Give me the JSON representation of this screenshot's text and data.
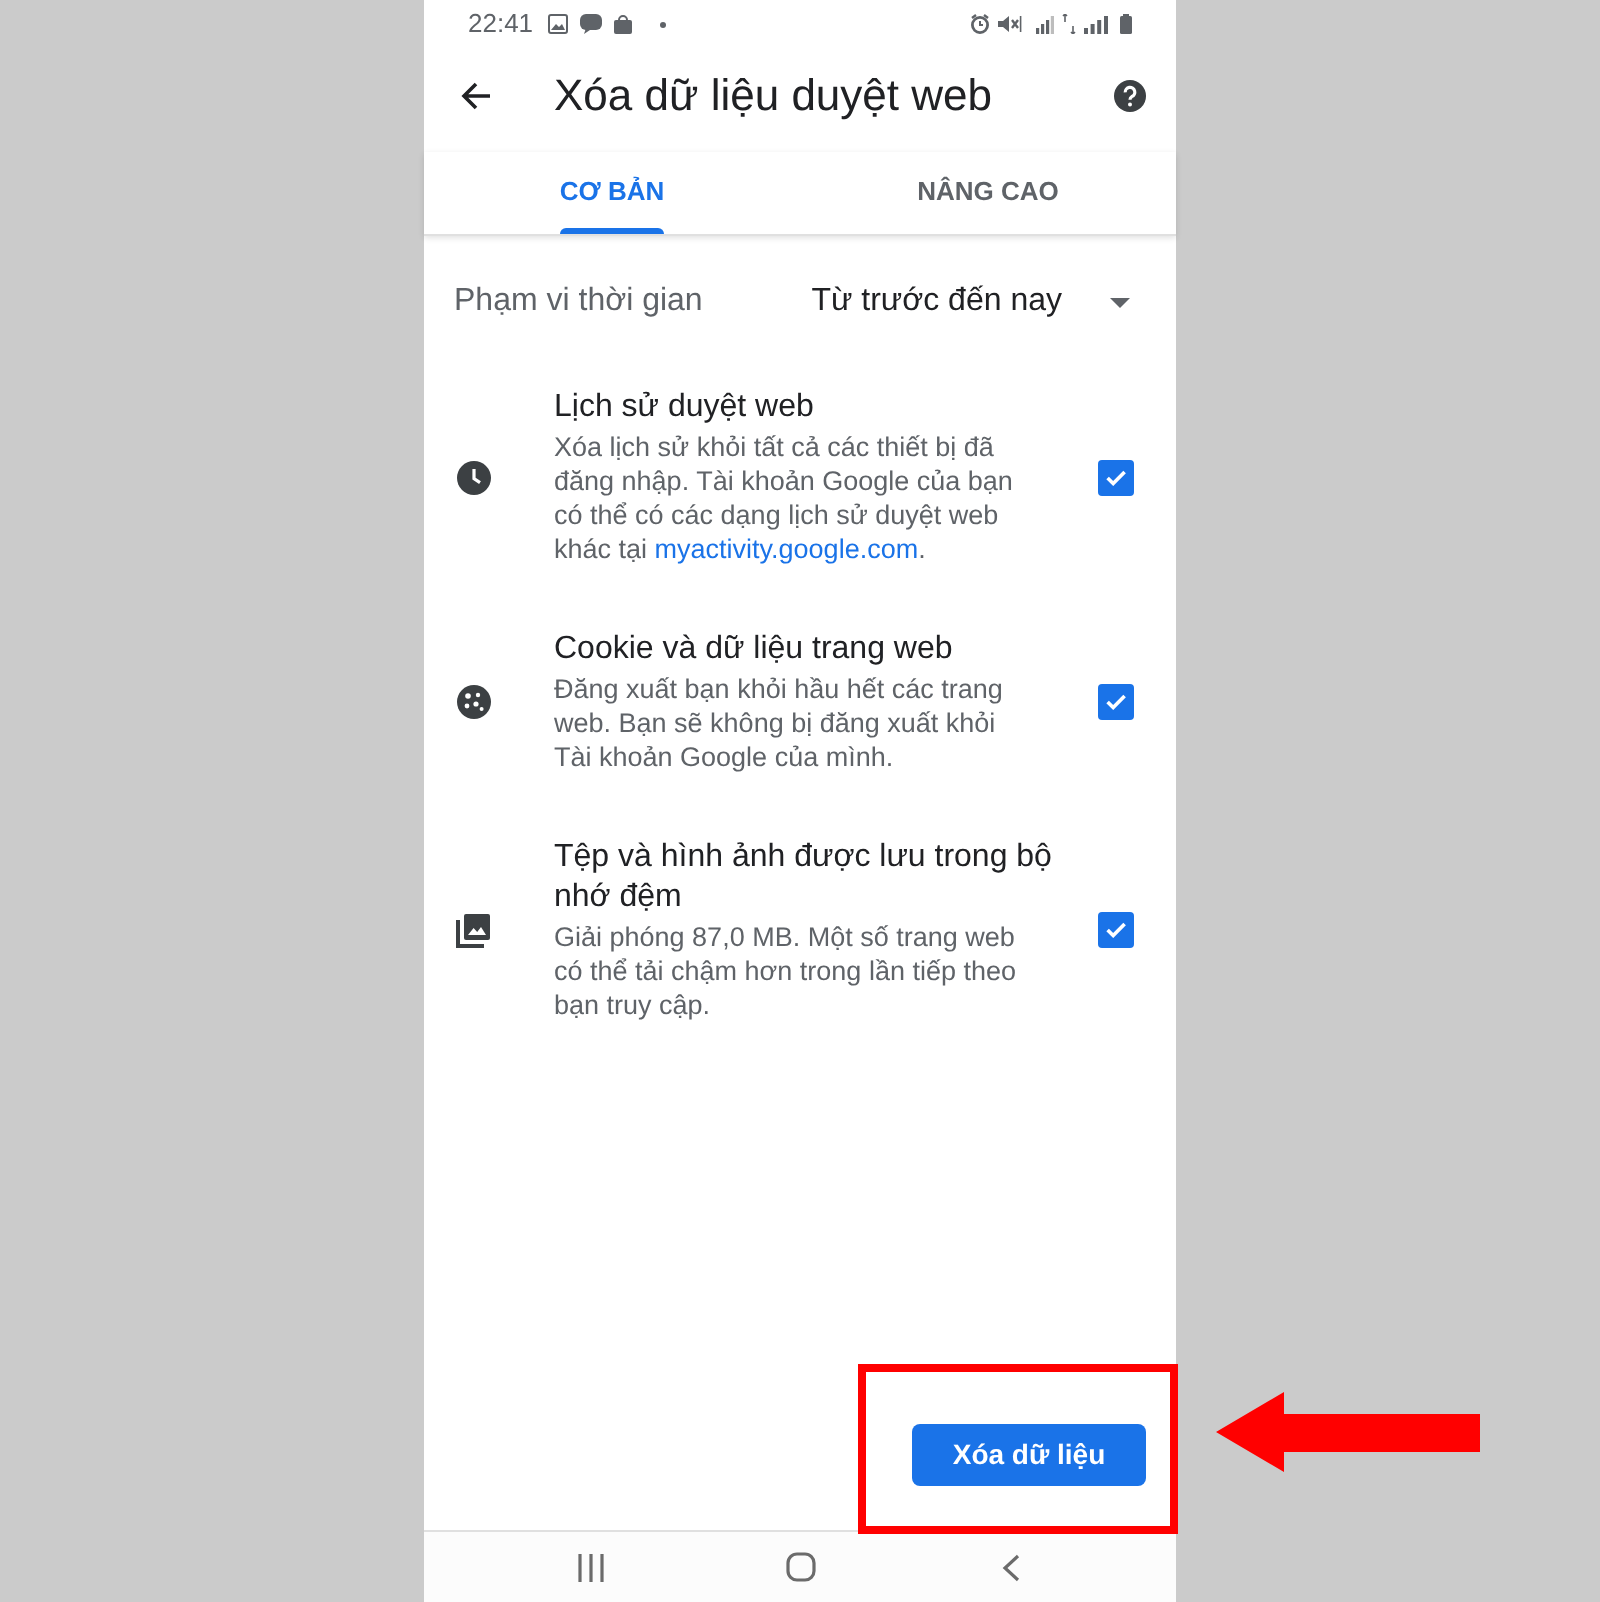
{
  "status_bar": {
    "time": "22:41"
  },
  "toolbar": {
    "title": "Xóa dữ liệu duyệt web"
  },
  "tabs": [
    {
      "label": "CƠ BẢN",
      "selected": true
    },
    {
      "label": "NÂNG CAO",
      "selected": false
    }
  ],
  "time_range": {
    "label": "Phạm vi thời gian",
    "value": "Từ trước đến nay"
  },
  "items": [
    {
      "kind": "history",
      "title": "Lịch sử duyệt web",
      "description": [
        {
          "text": "Xóa lịch sử khỏi tất cả các thiết bị đã đăng nhập. Tài khoản Google của bạn có thể có các dạng lịch sử duyệt web khác tại "
        },
        {
          "kind": "link",
          "text": "myactivity.google.com"
        },
        {
          "text": "."
        }
      ],
      "checked": true
    },
    {
      "kind": "cookies",
      "title": "Cookie và dữ liệu trang web",
      "description": [
        {
          "text": "Đăng xuất bạn khỏi hầu hết các trang web. Bạn sẽ không bị đăng xuất khỏi Tài khoản Google của mình."
        }
      ],
      "checked": true
    },
    {
      "kind": "cache",
      "title": "Tệp và hình ảnh được lưu trong bộ nhớ đệm",
      "description": [
        {
          "text": "Giải phóng 87,0 MB. Một số trang web có thể tải chậm hơn trong lần tiếp theo bạn truy cập."
        }
      ],
      "checked": true
    }
  ],
  "action_button": {
    "label": "Xóa dữ liệu"
  },
  "callouts": {
    "frame": true,
    "arrow": true
  }
}
